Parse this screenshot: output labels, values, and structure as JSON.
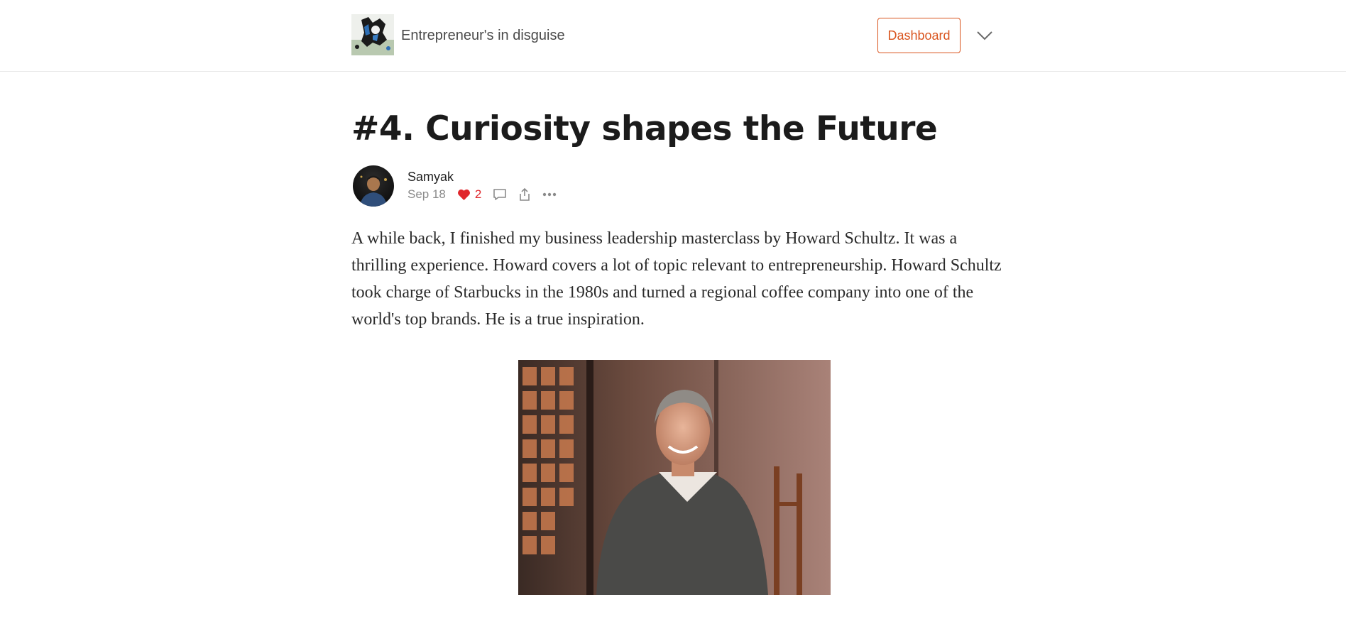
{
  "header": {
    "publication_name": "Entrepreneur's in disguise",
    "dashboard_label": "Dashboard",
    "accent_color": "#d9541e"
  },
  "post": {
    "title": "#4. Curiosity shapes the Future",
    "author": "Samyak",
    "date": "Sep 18",
    "likes": "2",
    "body": "A while back, I finished my business leadership masterclass by Howard Schultz. It was a thrilling experience. Howard covers a lot of topic relevant to entrepreneurship. Howard Schultz took charge of Starbucks in the 1980s and turned a regional coffee company into one of the world's top brands. He is a true inspiration."
  },
  "icons": {
    "like": "heart-icon",
    "comment": "comment-icon",
    "share": "share-icon",
    "more": "more-icon",
    "menu": "chevron-down-icon"
  }
}
